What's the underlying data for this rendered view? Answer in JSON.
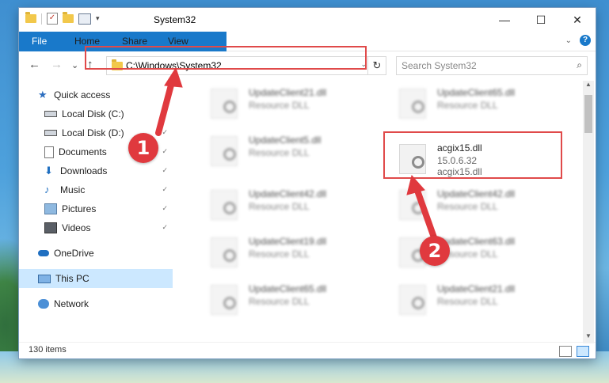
{
  "window": {
    "title": "System32",
    "controls": {
      "minimize": "—",
      "maximize": "☐",
      "close": "✕"
    }
  },
  "ribbon": {
    "tabs": [
      {
        "label": "File"
      },
      {
        "label": "Home"
      },
      {
        "label": "Share"
      },
      {
        "label": "View"
      }
    ],
    "help": "?"
  },
  "navbar": {
    "back": "←",
    "forward": "→",
    "recent": "⌄",
    "up": "↑",
    "address": "C:\\Windows\\System32",
    "refresh": "↻",
    "search_placeholder": "Search System32",
    "search_icon": "⌕"
  },
  "sidebar": {
    "items": [
      {
        "label": "Quick access",
        "icon": "star-icon"
      },
      {
        "label": "Local Disk (C:)",
        "icon": "drive-icon",
        "pinned": true
      },
      {
        "label": "Local Disk (D:)",
        "icon": "drive-icon",
        "pinned": true
      },
      {
        "label": "Documents",
        "icon": "documents-icon",
        "pinned": true
      },
      {
        "label": "Downloads",
        "icon": "downloads-icon",
        "pinned": true
      },
      {
        "label": "Music",
        "icon": "music-icon",
        "pinned": true
      },
      {
        "label": "Pictures",
        "icon": "pictures-icon",
        "pinned": true
      },
      {
        "label": "Videos",
        "icon": "videos-icon",
        "pinned": true
      },
      {
        "label": "OneDrive",
        "icon": "cloud-icon"
      },
      {
        "label": "This PC",
        "icon": "computer-icon",
        "selected": true
      },
      {
        "label": "Network",
        "icon": "network-icon"
      }
    ]
  },
  "files": [
    {
      "name": "UpdateClient21.dll",
      "type": "Resource DLL"
    },
    {
      "name": "UpdateClient65.dll",
      "type": "Resource DLL"
    },
    {
      "name": "UpdateClient5.dll",
      "type": "Resource DLL"
    },
    {
      "name": "acgix15.dll",
      "version": "15.0.6.32",
      "desc": "acgix15.dll"
    },
    {
      "name": "UpdateClient42.dll",
      "type": "Resource DLL"
    },
    {
      "name": "UpdateClient42.dll",
      "type": "Resource DLL"
    },
    {
      "name": "UpdateClient19.dll",
      "type": "Resource DLL"
    },
    {
      "name": "UpdateClient63.dll",
      "type": "Resource DLL"
    },
    {
      "name": "UpdateClient65.dll",
      "type": "Resource DLL"
    },
    {
      "name": "UpdateClient21.dll",
      "type": "Resource DLL"
    }
  ],
  "status": {
    "count": "130 items"
  },
  "annotations": {
    "step1": "1",
    "step2": "2"
  },
  "colors": {
    "accent": "#1979ca",
    "highlight": "#e04a4a",
    "selected": "#cce8ff"
  }
}
